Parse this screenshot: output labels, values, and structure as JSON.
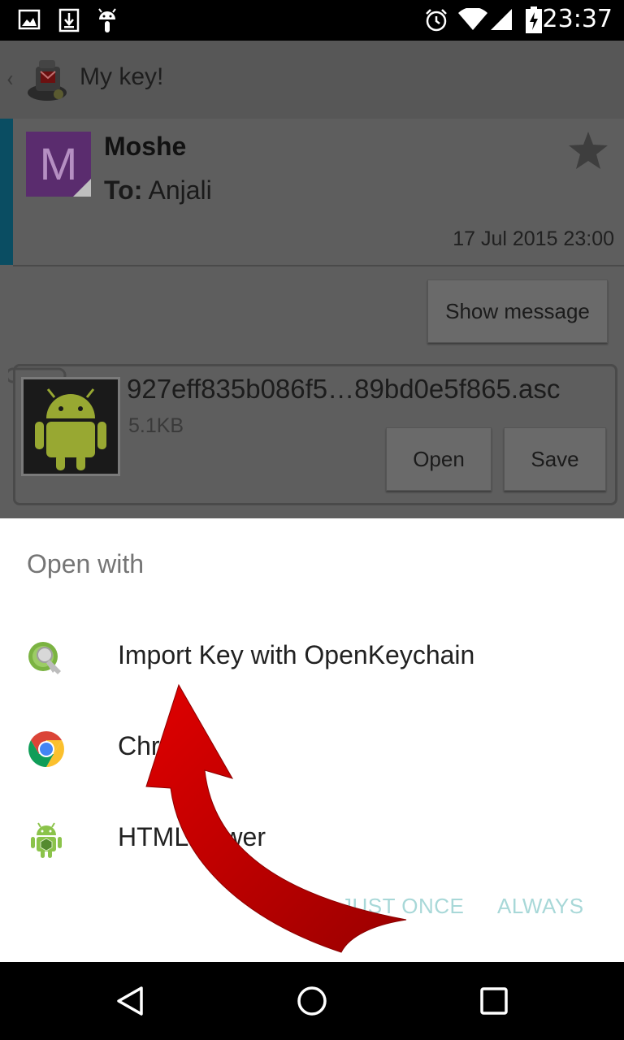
{
  "status_bar": {
    "time": "23:37",
    "icons": [
      "image-icon",
      "download-icon",
      "android-icon",
      "alarm-icon",
      "wifi-icon",
      "signal-icon",
      "battery-icon"
    ]
  },
  "action_bar": {
    "back_glyph": "‹",
    "title": "My key!"
  },
  "message": {
    "avatar_letter": "M",
    "sender": "Moshe",
    "to_prefix": "To:",
    "to_name": "Anjali",
    "date": "17 Jul 2015 23:00",
    "show_message_label": "Show message"
  },
  "attachment": {
    "filename": "927eff835b086f5…89bd0e5f865.asc",
    "size": "5.1KB",
    "open_label": "Open",
    "save_label": "Save"
  },
  "dialog": {
    "title": "Open with",
    "items": [
      {
        "label": "Import Key with OpenKeychain",
        "icon": "openkeychain-icon"
      },
      {
        "label": "Chrome",
        "icon": "chrome-icon"
      },
      {
        "label": "HTMLViewer",
        "icon": "android-app-icon"
      }
    ],
    "just_once_label": "JUST ONCE",
    "always_label": "ALWAYS"
  },
  "colors": {
    "dim_background": "#5e5e5e",
    "accent_bar": "#0a4d62",
    "avatar_bg": "#5a2c6e",
    "dialog_button": "#a8d8d8",
    "arrow_red": "#d40000"
  }
}
